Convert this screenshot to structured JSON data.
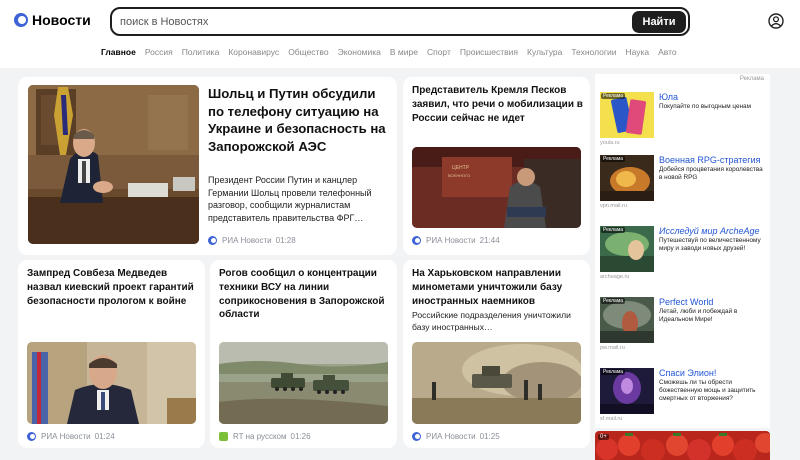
{
  "header": {
    "logo_text": "Новости",
    "search_placeholder": "поиск в Новостях",
    "search_button": "Найти"
  },
  "nav": {
    "items": [
      "Главное",
      "Россия",
      "Политика",
      "Коронавирус",
      "Общество",
      "Экономика",
      "В мире",
      "Спорт",
      "Происшествия",
      "Культура",
      "Технологии",
      "Наука",
      "Авто"
    ],
    "active_index": 0
  },
  "news": [
    {
      "title": "Шольц и Путин обсудили по телефону ситуацию на Украине и безопасность на Запорожской АЭС",
      "lead": "Президент России Путин и канцлер Германии Шольц провели телефонный разговор, сообщили журналистам представитель правительства ФРГ…",
      "source": "РИА Новости",
      "time": "01:28"
    },
    {
      "title": "Представитель Кремля Песков заявил, что речи о мобилизации в России сейчас не идет",
      "source": "РИА Новости",
      "time": "21:44"
    },
    {
      "title": "Зампред Совбеза Медведев назвал киевский проект гарантий безопасности прологом к войне",
      "source": "РИА Новости",
      "time": "01:24"
    },
    {
      "title": "Рогов сообщил о концентрации техники ВСУ на линии соприкосновения в Запорожской области",
      "source": "RT на русском",
      "time": "01:26"
    },
    {
      "title": "На Харьковском направлении минометами уничтожили базу иностранных наемников",
      "lead": "Российские подразделения уничтожили базу иностранных…",
      "source": "РИА Новости",
      "time": "01:25"
    }
  ],
  "ads": {
    "label": "Реклама",
    "badge": "Реклама",
    "items": [
      {
        "title": "Юла",
        "desc": "Покупайте по выгодным ценам",
        "domain": "youla.ru"
      },
      {
        "title": "Военная RPG-стратегия",
        "desc": "Добейся процветания королевства в новой RPG",
        "domain": "vpn.mail.ru"
      },
      {
        "title": "Исследуй мир ArcheAge",
        "desc": "Путешествуй по величественному миру и заводи новых друзей!",
        "domain": "archeage.ru"
      },
      {
        "title": "Perfect World",
        "desc": "Летай, люби и побеждай в Идеальном Мире!",
        "domain": "pw.mail.ru"
      },
      {
        "title": "Спаси Элион!",
        "desc": "Сможешь ли ты обрести божественную мощь и защитить смертных от вторжения?",
        "domain": "sf.mail.ru"
      }
    ],
    "age_badge": "0+"
  },
  "colors": {
    "accent": "#3d63d6",
    "ad_link": "#2256d6",
    "search_button_bg": "#1e1e1e",
    "background": "#f2f3f5"
  },
  "icons": {
    "profile": "user-icon",
    "logo": "news-logo-icon"
  }
}
